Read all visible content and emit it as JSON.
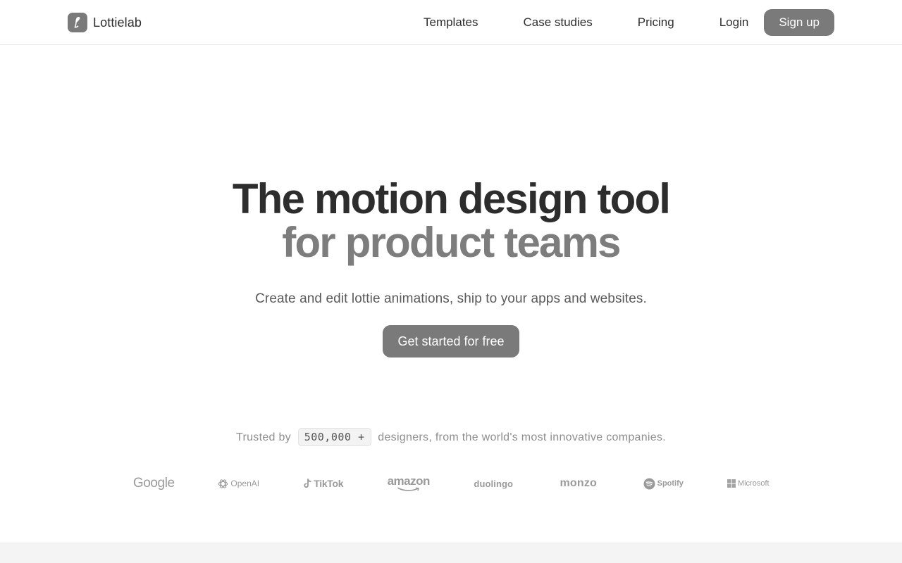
{
  "header": {
    "brand_name": "Lottielab",
    "nav": {
      "templates": "Templates",
      "case_studies": "Case studies",
      "pricing": "Pricing",
      "login": "Login",
      "signup": "Sign up"
    }
  },
  "hero": {
    "headline_line1": "The motion design tool",
    "headline_line2": "for product teams",
    "subtitle": "Create and edit lottie animations, ship to your apps and websites.",
    "cta_label": "Get started for free"
  },
  "trusted": {
    "prefix": "Trusted by",
    "count": "500,000 +",
    "suffix": "designers, from the world's most innovative companies."
  },
  "logos": {
    "google": "Google",
    "openai": "OpenAI",
    "tiktok": "TikTok",
    "amazon": "amazon",
    "duolingo": "duolingo",
    "monzo": "monzo",
    "spotify": "Spotify",
    "microsoft": "Microsoft"
  },
  "colors": {
    "button_fill": "#7a7a7a",
    "headline_dark": "#2d2d2d",
    "headline_light": "#7d7d7d",
    "logo_gray": "#9a9a9a"
  }
}
